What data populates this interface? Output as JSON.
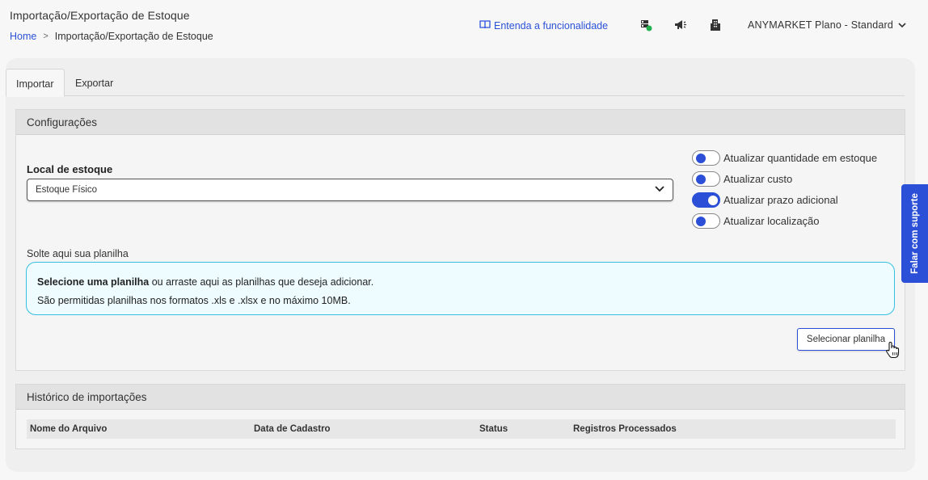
{
  "header": {
    "title": "Importação/Exportação de Estoque",
    "breadcrumb": {
      "home": "Home",
      "separator": ">",
      "current": "Importação/Exportação de Estoque"
    },
    "help_link": "Entenda a funcionalidade",
    "icons": [
      "server-status-icon",
      "megaphone-icon",
      "building-icon"
    ],
    "plan_label": "ANYMARKET Plano - Standard",
    "status_color": "#22b14c"
  },
  "tabs": [
    {
      "label": "Importar",
      "active": true
    },
    {
      "label": "Exportar",
      "active": false
    }
  ],
  "config": {
    "title": "Configurações",
    "stock_location_label": "Local de estoque",
    "stock_location_value": "Estoque Físico",
    "toggles": [
      {
        "label": "Atualizar quantidade em estoque",
        "on": false
      },
      {
        "label": "Atualizar custo",
        "on": false
      },
      {
        "label": "Atualizar prazo adicional",
        "on": true
      },
      {
        "label": "Atualizar localização",
        "on": false
      }
    ],
    "drop_label": "Solte aqui sua planilha",
    "drop_bold": "Selecione uma planilha",
    "drop_text": " ou arraste aqui as planilhas que deseja adicionar.",
    "drop_note": "São permitidas planilhas nos formatos .xls e .xlsx e no máximo 10MB.",
    "select_button": "Selecionar planilha"
  },
  "history": {
    "title": "Histórico de importações",
    "columns": [
      "Nome do Arquivo",
      "Data de Cadastro",
      "Status",
      "Registros Processados"
    ]
  },
  "support_tab": "Falar com suporte",
  "colors": {
    "accent": "#2b4fd6",
    "dropzone_border": "#35bfe3",
    "dropzone_bg": "#eefcff"
  }
}
